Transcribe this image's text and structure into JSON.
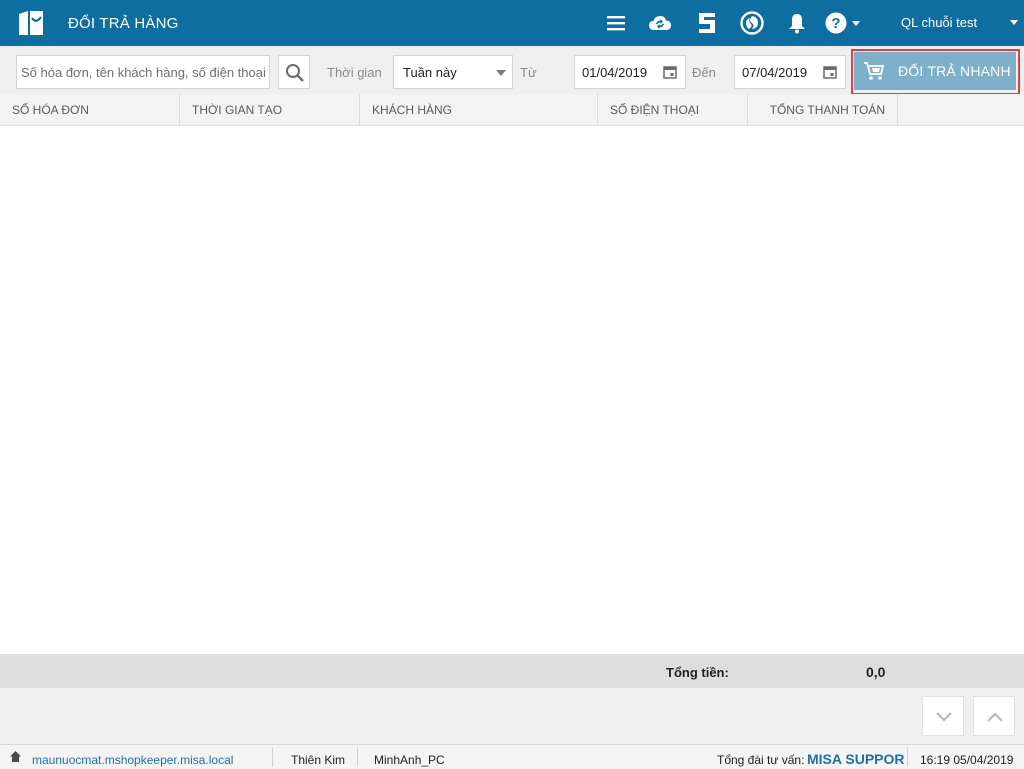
{
  "header": {
    "title": "ĐỔI TRẢ HÀNG",
    "user_name": "QL chuỗi test",
    "icons": [
      "menu-icon",
      "cloud-sync-icon",
      "s-badge-icon",
      "swirl-icon",
      "bell-icon",
      "help-icon"
    ]
  },
  "filters": {
    "search_placeholder": "Số hóa đơn, tên khách hàng, số điện thoại",
    "time_label": "Thời gian",
    "period_value": "Tuần này",
    "from_label": "Từ",
    "from_date": "01/04/2019",
    "to_label": "Đến",
    "to_date": "07/04/2019",
    "quick_return_label": "ĐỔI TRẢ NHANH"
  },
  "table": {
    "columns": [
      "SỐ HÓA ĐƠN",
      "THỜI GIAN TẠO",
      "KHÁCH HÀNG",
      "SỐ ĐIỆN THOẠI",
      "TỔNG THANH TOÁN"
    ],
    "rows": []
  },
  "totals": {
    "label": "Tổng tiền:",
    "value": "0,0"
  },
  "statusbar": {
    "domain": "maunuocmat.mshopkeeper.misa.local",
    "user": "Thiên Kim",
    "machine": "MinhAnh_PC",
    "support_label": "Tổng đài tư vấn:",
    "support_value": "MISA SUPPOR",
    "datetime": "16:19 05/04/2019"
  },
  "colors": {
    "header_bg": "#0e6ea1",
    "quick_button": "#7fb0ca",
    "highlight_border": "#e04040",
    "link": "#1f6fa8"
  }
}
